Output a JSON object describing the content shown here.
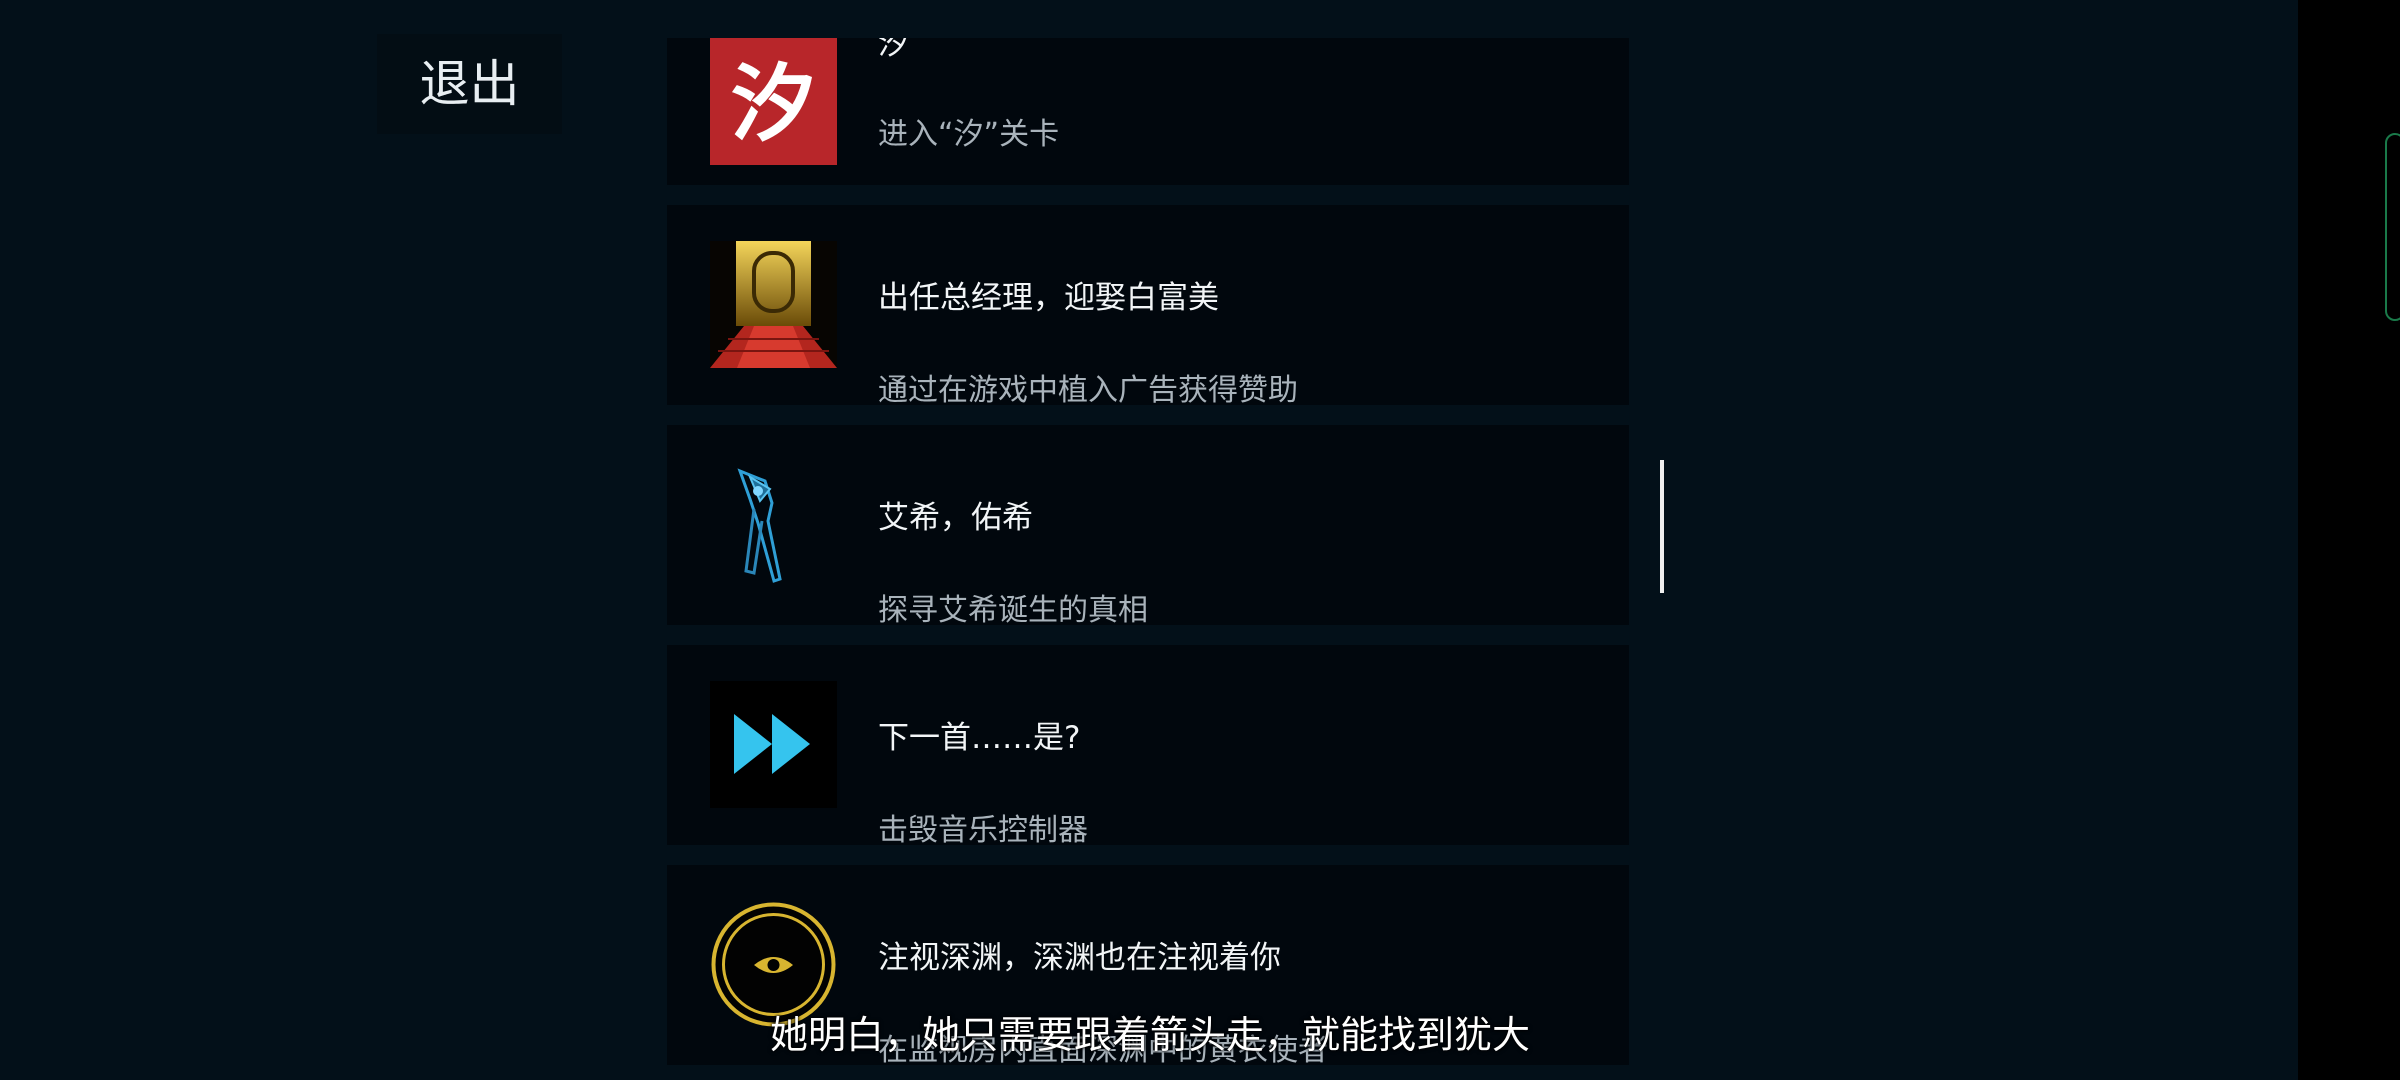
{
  "exit_label": "退出",
  "achievements": [
    {
      "title": "汐",
      "description": "进入“汐”关卡",
      "icon": "xi-character-icon",
      "icon_char": "汐"
    },
    {
      "title": "出任总经理，迎娶白富美",
      "description": "通过在游戏中植入广告获得赞助",
      "icon": "golden-door-icon"
    },
    {
      "title": "艾希，佑希",
      "description": "探寻艾希诞生的真相",
      "icon": "blue-sword-icon"
    },
    {
      "title": "下一首……是?",
      "description": "击毁音乐控制器",
      "icon": "fast-forward-icon"
    },
    {
      "title": "注视深渊，深渊也在注视着你",
      "description": "在监视房内直面深渊中的黄衣使者",
      "icon": "eye-emblem-icon"
    }
  ],
  "subtitle": "她明白，她只需要跟着箭头走，就能找到犹大",
  "colors": {
    "background": "#031019",
    "card": "#01070d",
    "title_text": "#f2f5f7",
    "desc_text": "#a9b3bb",
    "xi_icon_red": "#b8262a",
    "fast_forward_blue": "#35c4ee",
    "eye_emblem_gold": "#d8b530"
  }
}
